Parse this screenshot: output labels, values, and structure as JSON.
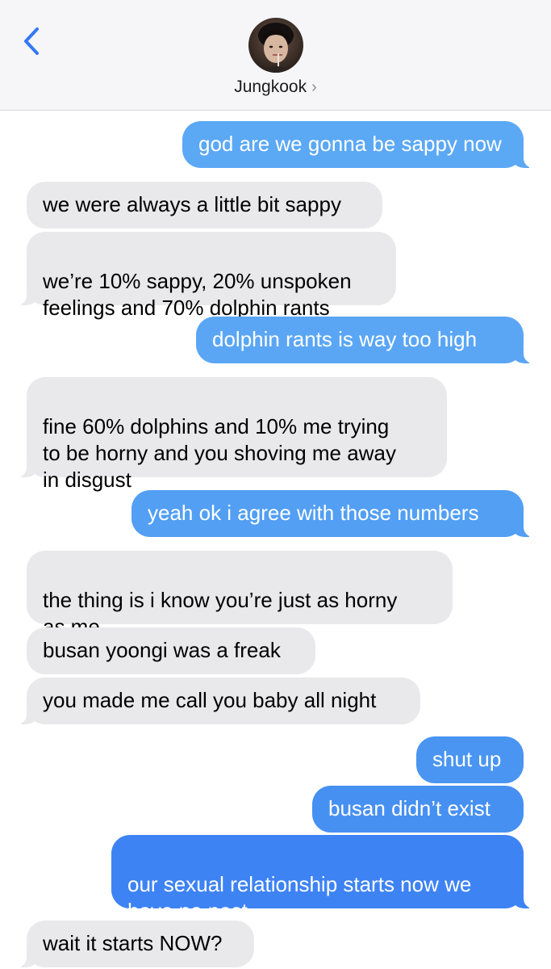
{
  "header": {
    "contact_name": "Jungkook",
    "chevron": "›",
    "back_icon": "chevron-left-icon",
    "accent_color": "#3478f6"
  },
  "colors": {
    "incoming": "#e9e9eb",
    "outgoing_light": "#5ba8f5",
    "outgoing_mid": "#4a95f2",
    "outgoing_dark": "#3478f6"
  },
  "messages": [
    {
      "from": "me",
      "text": "god are we gonna be sappy now"
    },
    {
      "from": "them",
      "text": "we were always a little bit sappy"
    },
    {
      "from": "them",
      "text": "we’re 10% sappy, 20% unspoken\nfeelings and 70% dolphin rants"
    },
    {
      "from": "me",
      "text": "dolphin rants is way too high"
    },
    {
      "from": "them",
      "text": "fine 60% dolphins and 10% me trying\nto be horny and you shoving me away\nin disgust"
    },
    {
      "from": "me",
      "text": "yeah ok i agree with those numbers"
    },
    {
      "from": "them",
      "text": "the thing is i know you’re just as horny\nas me"
    },
    {
      "from": "them",
      "text": "busan yoongi was a freak"
    },
    {
      "from": "them",
      "text": "you made me call you baby all night"
    },
    {
      "from": "me",
      "text": "shut up"
    },
    {
      "from": "me",
      "text": "busan didn’t exist"
    },
    {
      "from": "me",
      "text": "our sexual relationship starts now we\nhave no past"
    },
    {
      "from": "them",
      "text": "wait it starts NOW?"
    }
  ]
}
